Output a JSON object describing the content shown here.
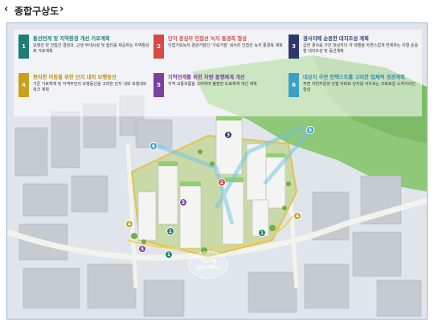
{
  "header": {
    "title": "종합구상도",
    "back_icon": "chevron-left-icon",
    "forward_icon": "chevron-right-icon"
  },
  "cards": [
    {
      "num": "1",
      "color": "#1e7d74",
      "title": "통선연계 및 지역환경 개선 가로계획",
      "body": "보행선 및 인접선 결권과, 근생 부대시설 및 쉼터를 제공하는 지역활성화 가로계획"
    },
    {
      "num": "2",
      "color": "#d84a4a",
      "title": "단지 중심부 인접선 녹지 통경축 형성",
      "body": "인접가로녹지 경관거점인 '가로거점' 세서리 인접선 녹지 통경축 계획"
    },
    {
      "num": "3",
      "color": "#2b3a6b",
      "title": "경사지에 순응한 대지조성 계획",
      "body": "급한 경사를 가진 대상지의 각 레벨을 자연스럽게 연계하는 지형 순응형 대지조성 및 동선계획"
    },
    {
      "num": "4",
      "color": "#c8a21a",
      "title": "편리한 이동을 위한 단지 내외 보행동선",
      "body": "기존 가로체계 및 지역주민의 보행동선을 고려한 단지 내외 보행네트 워크 계획"
    },
    {
      "num": "5",
      "color": "#7b3fa0",
      "title": "지역연계를 위한 차량 통행체계 개선",
      "body": "지역 교통흐름을 고려하여 불편한 도로체계 개선 계획"
    },
    {
      "num": "6",
      "color": "#3aa0c8",
      "title": "대상지 주변 컨텍스트를 고려한 입체적 경관계획",
      "body": "주변 자연자원과 인접 아파트 단지를 아우르는 조화로운 스카이라인 형성"
    }
  ],
  "plaza_label": [
    "가로거점",
    "오픈스페이스"
  ],
  "map_markers": [
    {
      "num": "1",
      "color": "#1e7d74"
    },
    {
      "num": "1",
      "color": "#1e7d74"
    },
    {
      "num": "1",
      "color": "#1e7d74"
    },
    {
      "num": "2",
      "color": "#d84a4a"
    },
    {
      "num": "3",
      "color": "#2b3a6b"
    },
    {
      "num": "4",
      "color": "#c8a21a"
    },
    {
      "num": "4",
      "color": "#c8a21a"
    },
    {
      "num": "5",
      "color": "#7b3fa0"
    },
    {
      "num": "5",
      "color": "#7b3fa0"
    },
    {
      "num": "6",
      "color": "#3aa0c8"
    },
    {
      "num": "6",
      "color": "#3aa0c8"
    }
  ]
}
